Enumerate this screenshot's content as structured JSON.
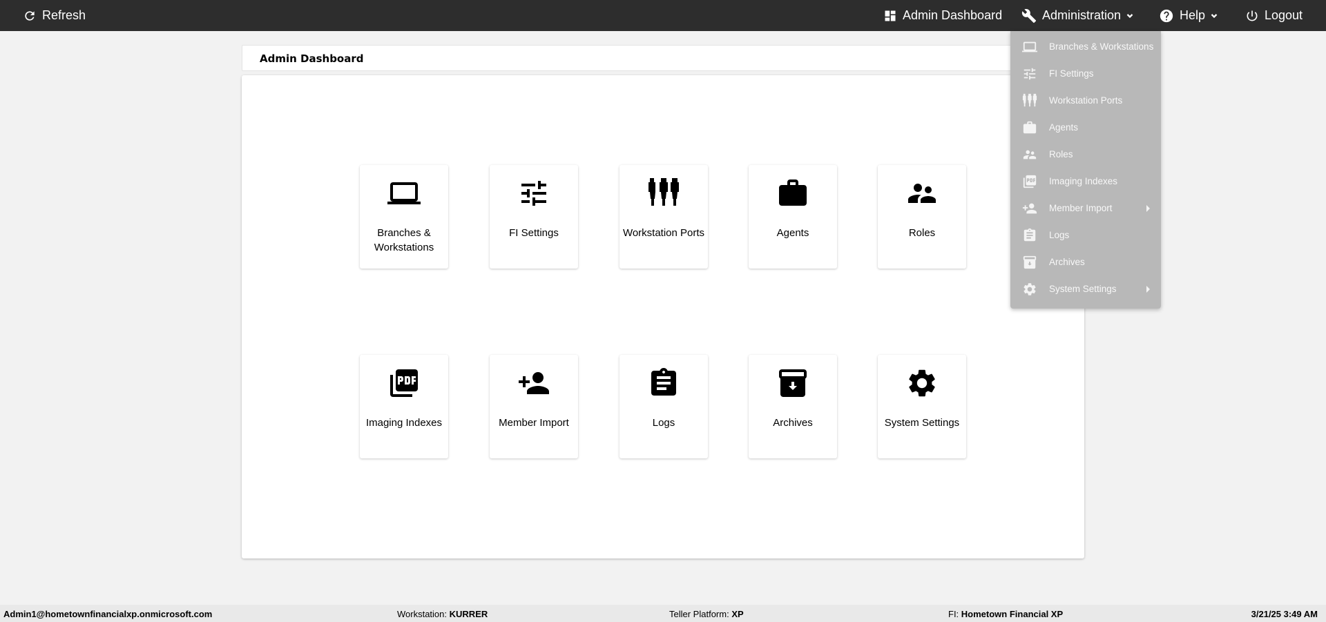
{
  "topbar": {
    "refresh_label": "Refresh",
    "admin_dashboard_label": "Admin Dashboard",
    "administration_label": "Administration",
    "help_label": "Help",
    "logout_label": "Logout"
  },
  "page": {
    "title": "Admin Dashboard"
  },
  "tiles": [
    {
      "label": "Branches & Workstations",
      "icon": "laptop-icon"
    },
    {
      "label": "FI Settings",
      "icon": "tune-icon"
    },
    {
      "label": "Workstation Ports",
      "icon": "ports-icon"
    },
    {
      "label": "Agents",
      "icon": "briefcase-icon"
    },
    {
      "label": "Roles",
      "icon": "people-icon"
    },
    {
      "label": "Imaging Indexes",
      "icon": "pdf-icon"
    },
    {
      "label": "Member Import",
      "icon": "person-add-icon"
    },
    {
      "label": "Logs",
      "icon": "clipboard-icon"
    },
    {
      "label": "Archives",
      "icon": "archive-icon"
    },
    {
      "label": "System Settings",
      "icon": "gear-icon"
    }
  ],
  "admin_menu": {
    "items": [
      {
        "label": "Branches & Workstations",
        "icon": "laptop-icon"
      },
      {
        "label": "FI Settings",
        "icon": "tune-icon"
      },
      {
        "label": "Workstation Ports",
        "icon": "ports-icon"
      },
      {
        "label": "Agents",
        "icon": "briefcase-icon"
      },
      {
        "label": "Roles",
        "icon": "people-icon"
      },
      {
        "label": "Imaging Indexes",
        "icon": "pdf-icon"
      },
      {
        "label": "Member Import",
        "icon": "person-add-icon",
        "submenu": true
      },
      {
        "label": "Logs",
        "icon": "clipboard-icon"
      },
      {
        "label": "Archives",
        "icon": "archive-icon"
      },
      {
        "label": "System Settings",
        "icon": "gear-icon",
        "submenu": true
      }
    ]
  },
  "status": {
    "user": "Admin1@hometownfinancialxp.onmicrosoft.com",
    "workstation_label": "Workstation:",
    "workstation_value": "KURRER",
    "platform_label": "Teller Platform:",
    "platform_value": "XP",
    "fi_label": "FI:",
    "fi_value": "Hometown Financial XP",
    "datetime": "3/21/25 3:49 AM"
  }
}
